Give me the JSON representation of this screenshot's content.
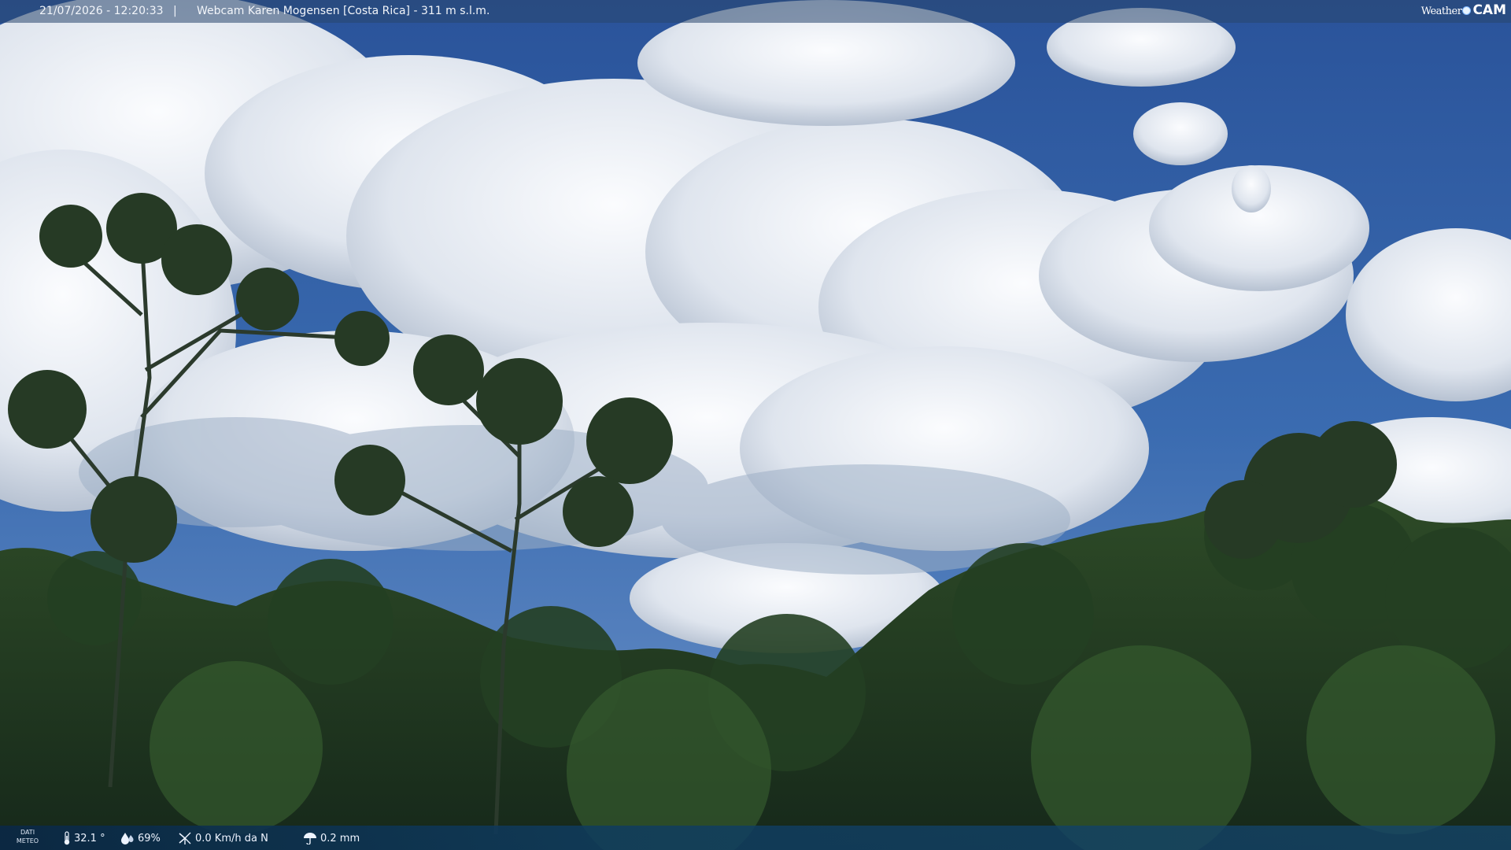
{
  "header": {
    "timestamp": "21/07/2026 - 12:20:33",
    "separator": "|",
    "camera_title": "Webcam Karen Mogensen [Costa Rica]  - 311 m s.l.m.",
    "logo_weather": "Weather",
    "logo_cam": "CAM"
  },
  "footer": {
    "dati_label_1": "DATI",
    "dati_label_2": "METEO",
    "temperature": "32.1 °",
    "humidity": "69%",
    "wind": "0.0 Km/h da N",
    "rain": "0.2 mm",
    "icons": [
      "thermometer-icon",
      "humidity-drop-icon",
      "wind-icon",
      "rain-icon"
    ]
  },
  "scene": {
    "sky_color": "#2f5ea3",
    "cloud_color": "#eef2f7",
    "forest_color": "#1f3a1c"
  }
}
